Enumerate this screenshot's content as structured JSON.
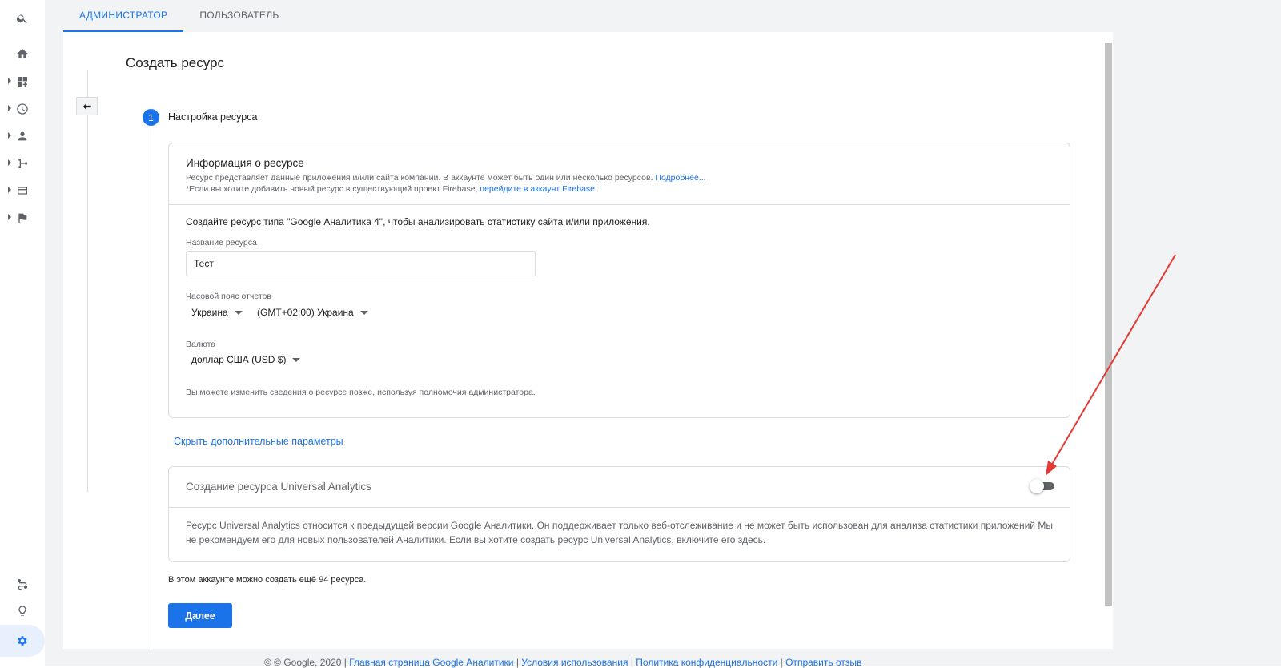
{
  "tabs": [
    {
      "label": "АДМИНИСТРАТОР",
      "active": true
    },
    {
      "label": "ПОЛЬЗОВАТЕЛЬ",
      "active": false
    }
  ],
  "page_title": "Создать ресурс",
  "step": {
    "number": "1",
    "label": "Настройка ресурса"
  },
  "info_card": {
    "title": "Информация о ресурсе",
    "line1_text": "Ресурс представляет данные приложения и/или сайта компании. В аккаунте может быть один или несколько ресурсов.",
    "line1_link": "Подробнее...",
    "line2_text": "*Если вы хотите добавить новый ресурс в существующий проект Firebase,",
    "line2_link": "перейдите в аккаунт Firebase",
    "line2_end": ".",
    "intro": "Создайте ресурс типа \"Google Аналитика 4\", чтобы анализировать статистику сайта и/или приложения.",
    "name_label": "Название ресурса",
    "name_value": "Тест",
    "timezone_label": "Часовой пояс отчетов",
    "country_value": "Украина",
    "timezone_value": "(GMT+02:00) Украина",
    "currency_label": "Валюта",
    "currency_value": "доллар США (USD $)",
    "note": "Вы можете изменить сведения о ресурсе позже, используя полномочия администратора."
  },
  "hide_link": "Скрыть дополнительные параметры",
  "ua_card": {
    "title": "Создание ресурса Universal Analytics",
    "toggle_on": false,
    "desc": "Ресурс Universal Analytics относится к предыдущей версии Google Аналитики. Он поддерживает только веб-отслеживание и не может быть использован для анализа статистики приложений Мы не рекомендуем его для новых пользователей Аналитики. Если вы хотите создать ресурс Universal Analytics, включите его здесь."
  },
  "remaining": "В этом аккаунте можно создать ещё 94 ресурса.",
  "next_button": "Далее",
  "footer": {
    "copyright": "© © Google, 2020 |",
    "links": [
      "Главная страница Google Аналитики",
      "Условия использования",
      "Политика конфиденциальности",
      "Отправить отзыв"
    ]
  },
  "rail_icons": [
    "search-icon",
    "home-icon",
    "dashboard-icon",
    "clock-icon",
    "person-icon",
    "flow-icon",
    "display-icon",
    "flag-icon",
    "route-icon",
    "lightbulb-icon",
    "gear-icon"
  ],
  "colors": {
    "accent": "#1a73e8",
    "annotation_arrow": "#e53935"
  }
}
